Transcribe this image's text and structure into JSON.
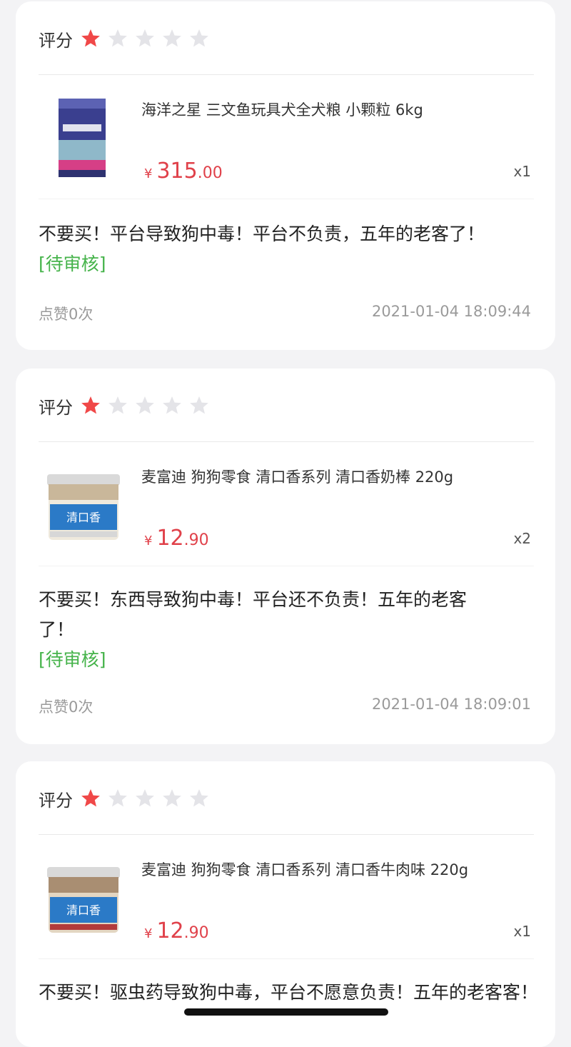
{
  "colors": {
    "accent_price": "#e0414a",
    "star_active": "#f04848",
    "star_inactive": "#e4e4e8",
    "pending": "#45b34a",
    "muted": "#9a9a9a",
    "background": "#f3f3f5"
  },
  "reviews": [
    {
      "rating_label": "评分",
      "rating": 1,
      "product_title": "海洋之星 三文鱼玩具犬全犬粮 小颗粒 6kg",
      "currency": "¥",
      "price_int": "315",
      "price_dec": ".00",
      "quantity": "x1",
      "comment": "不要买！平台导致狗中毒！平台不负责，五年的老客了！",
      "status": "[待审核]",
      "likes": "点赞0次",
      "timestamp": "2021-01-04 18:09:44",
      "image_icon": "dog-food-bag-icon"
    },
    {
      "rating_label": "评分",
      "rating": 1,
      "product_title": "麦富迪 狗狗零食 清口香系列 清口香奶棒 220g",
      "currency": "¥",
      "price_int": "12",
      "price_dec": ".90",
      "quantity": "x2",
      "comment": "不要买！东西导致狗中毒！平台还不负责！五年的老客了！",
      "status": "[待审核]",
      "likes": "点赞0次",
      "timestamp": "2021-01-04 18:09:01",
      "jar_label": "清口香",
      "image_icon": "snack-jar-icon"
    },
    {
      "rating_label": "评分",
      "rating": 1,
      "product_title": "麦富迪 狗狗零食 清口香系列 清口香牛肉味 220g",
      "currency": "¥",
      "price_int": "12",
      "price_dec": ".90",
      "quantity": "x1",
      "comment": "不要买！驱虫药导致狗中毒，平台不愿意负责！五年的老客客！",
      "jar_label": "清口香",
      "image_icon": "snack-jar-icon"
    }
  ]
}
